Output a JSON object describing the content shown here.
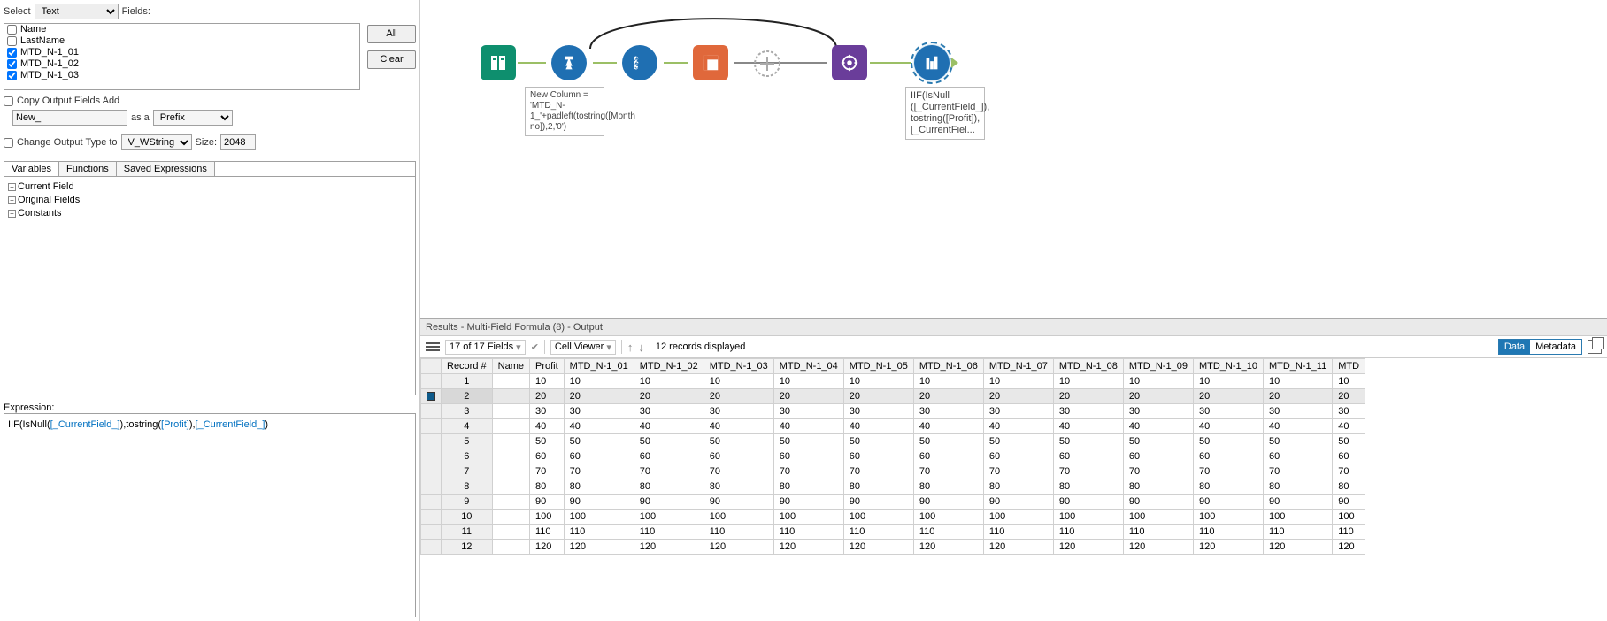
{
  "left": {
    "select_label": "Select",
    "select_value": "Text",
    "fields_label": "Fields:",
    "field_items": [
      {
        "label": "Name",
        "checked": false
      },
      {
        "label": "LastName",
        "checked": false
      },
      {
        "label": "MTD_N-1_01",
        "checked": true
      },
      {
        "label": "MTD_N-1_02",
        "checked": true
      },
      {
        "label": "MTD_N-1_03",
        "checked": true
      }
    ],
    "all_btn": "All",
    "clear_btn": "Clear",
    "copy_fields_label": "Copy Output Fields Add",
    "new_value": "New_",
    "as_a": "as a",
    "prefix_value": "Prefix",
    "change_type_label": "Change Output Type to",
    "type_value": "V_WString",
    "size_label": "Size:",
    "size_value": "2048",
    "tabs": {
      "variables": "Variables",
      "functions": "Functions",
      "saved": "Saved Expressions"
    },
    "tree": [
      "Current Field",
      "Original Fields",
      "Constants"
    ],
    "expression_label": "Expression:",
    "expression_plain": "IIF(IsNull([_CurrentField_]),tostring([Profit]),[_CurrentField_])"
  },
  "canvas": {
    "annot1": "New Column = 'MTD_N-1_'+padleft(tostring([Month no]),2,'0')",
    "annot2_l1": "IIF(IsNull",
    "annot2_l2": "([_CurrentField_]),",
    "annot2_l3": "tostring([Profit]),",
    "annot2_l4": "[_CurrentFiel..."
  },
  "results": {
    "title": "Results - Multi-Field Formula (8) - Output",
    "fields_dd": "17 of 17 Fields",
    "cell_viewer": "Cell Viewer",
    "records_msg": "12 records displayed",
    "data": "Data",
    "metadata": "Metadata",
    "columns": [
      "Record #",
      "Name",
      "Profit",
      "MTD_N-1_01",
      "MTD_N-1_02",
      "MTD_N-1_03",
      "MTD_N-1_04",
      "MTD_N-1_05",
      "MTD_N-1_06",
      "MTD_N-1_07",
      "MTD_N-1_08",
      "MTD_N-1_09",
      "MTD_N-1_10",
      "MTD_N-1_11",
      "MTD"
    ],
    "rows": [
      [
        "1",
        "",
        "10",
        "10",
        "10",
        "10",
        "10",
        "10",
        "10",
        "10",
        "10",
        "10",
        "10",
        "10",
        "10"
      ],
      [
        "2",
        "",
        "20",
        "20",
        "20",
        "20",
        "20",
        "20",
        "20",
        "20",
        "20",
        "20",
        "20",
        "20",
        "20"
      ],
      [
        "3",
        "",
        "30",
        "30",
        "30",
        "30",
        "30",
        "30",
        "30",
        "30",
        "30",
        "30",
        "30",
        "30",
        "30"
      ],
      [
        "4",
        "",
        "40",
        "40",
        "40",
        "40",
        "40",
        "40",
        "40",
        "40",
        "40",
        "40",
        "40",
        "40",
        "40"
      ],
      [
        "5",
        "",
        "50",
        "50",
        "50",
        "50",
        "50",
        "50",
        "50",
        "50",
        "50",
        "50",
        "50",
        "50",
        "50"
      ],
      [
        "6",
        "",
        "60",
        "60",
        "60",
        "60",
        "60",
        "60",
        "60",
        "60",
        "60",
        "60",
        "60",
        "60",
        "60"
      ],
      [
        "7",
        "",
        "70",
        "70",
        "70",
        "70",
        "70",
        "70",
        "70",
        "70",
        "70",
        "70",
        "70",
        "70",
        "70"
      ],
      [
        "8",
        "",
        "80",
        "80",
        "80",
        "80",
        "80",
        "80",
        "80",
        "80",
        "80",
        "80",
        "80",
        "80",
        "80"
      ],
      [
        "9",
        "",
        "90",
        "90",
        "90",
        "90",
        "90",
        "90",
        "90",
        "90",
        "90",
        "90",
        "90",
        "90",
        "90"
      ],
      [
        "10",
        "",
        "100",
        "100",
        "100",
        "100",
        "100",
        "100",
        "100",
        "100",
        "100",
        "100",
        "100",
        "100",
        "100"
      ],
      [
        "11",
        "",
        "110",
        "110",
        "110",
        "110",
        "110",
        "110",
        "110",
        "110",
        "110",
        "110",
        "110",
        "110",
        "110"
      ],
      [
        "12",
        "",
        "120",
        "120",
        "120",
        "120",
        "120",
        "120",
        "120",
        "120",
        "120",
        "120",
        "120",
        "120",
        "120"
      ]
    ]
  }
}
